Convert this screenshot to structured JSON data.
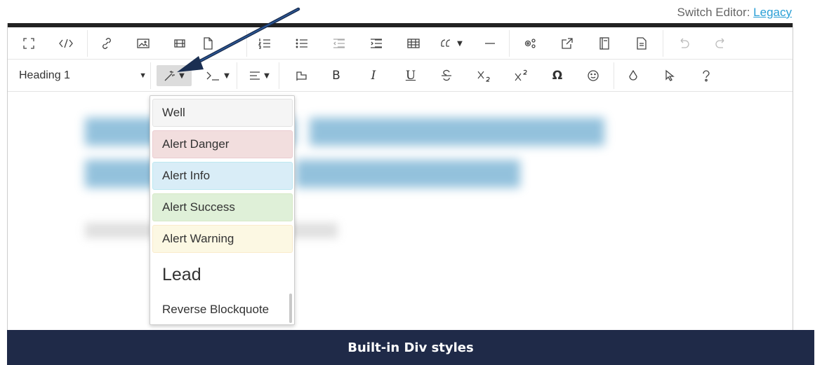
{
  "header": {
    "switch_label": "Switch Editor:",
    "switch_link": "Legacy"
  },
  "toolbar_row1": {
    "icons": [
      "fullscreen-icon",
      "source-code-icon",
      "link-icon",
      "image-icon",
      "video-icon",
      "file-icon",
      "ordered-list-icon",
      "unordered-list-icon",
      "outdent-icon",
      "indent-icon",
      "table-icon",
      "blockquote-icon",
      "horizontal-rule-icon",
      "settings-icon",
      "external-link-icon",
      "template-icon",
      "document-icon",
      "undo-icon",
      "redo-icon"
    ]
  },
  "toolbar_row2": {
    "format_select": "Heading 1",
    "icons": [
      "styles-icon",
      "code-icon",
      "align-icon",
      "clear-format-icon",
      "bold-icon",
      "italic-icon",
      "underline-icon",
      "strikethrough-icon",
      "subscript-icon",
      "superscript-icon",
      "special-char-icon",
      "emoji-icon",
      "color-icon",
      "pointer-icon",
      "help-icon"
    ],
    "bold": "B",
    "italic": "I",
    "underline": "U",
    "special_char": "Ω"
  },
  "dropdown": {
    "items": [
      {
        "label": "Well"
      },
      {
        "label": "Alert Danger"
      },
      {
        "label": "Alert Info"
      },
      {
        "label": "Alert Success"
      },
      {
        "label": "Alert Warning"
      },
      {
        "label": "Lead"
      },
      {
        "label": "Reverse Blockquote"
      }
    ]
  },
  "colors": {
    "banner_bg": "#1f2a48",
    "link": "#2a9fd6",
    "arrow": "#1f3f73"
  },
  "banner": {
    "label": "Built-in Div styles"
  }
}
